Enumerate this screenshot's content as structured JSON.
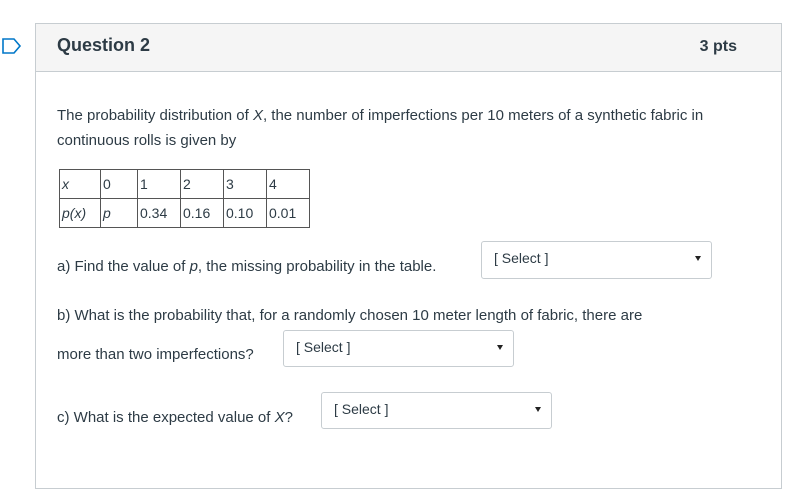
{
  "question": {
    "title": "Question 2",
    "points": "3 pts"
  },
  "intro": {
    "part1": "The probability distribution of ",
    "var": "X",
    "part2": ", the number of imperfections per 10 meters of a synthetic fabric in continuous rolls is given by"
  },
  "table": {
    "row1": [
      "x",
      "0",
      "1",
      "2",
      "3",
      "4"
    ],
    "row2": [
      "p(x)",
      "p",
      "0.34",
      "0.16",
      "0.10",
      "0.01"
    ]
  },
  "part_a": {
    "text1": "a) Find the value of ",
    "var": "p",
    "text2": ", the missing probability in the table.",
    "select": "[ Select ]"
  },
  "part_b": {
    "line1": "b) What is the probability that, for a randomly chosen 10 meter length of fabric, there are",
    "line2": "more than two imperfections?",
    "select": "[ Select ]"
  },
  "part_c": {
    "text1": "c) What is the expected value of ",
    "var": "X",
    "text2": "?",
    "select": "[ Select ]"
  }
}
